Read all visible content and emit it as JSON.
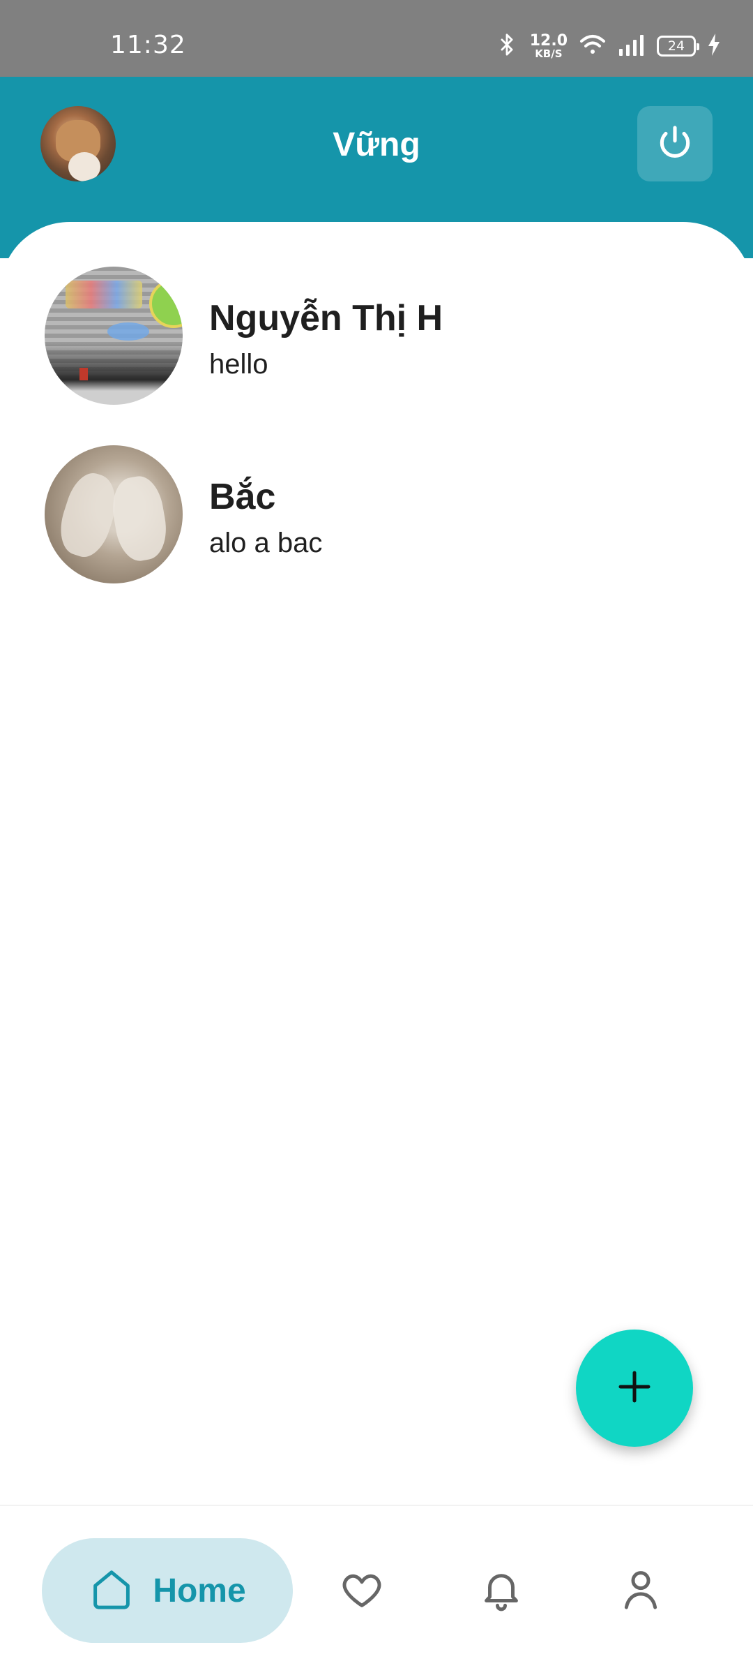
{
  "status_bar": {
    "time": "11:32",
    "net_speed_value": "12.0",
    "net_speed_unit": "KB/S",
    "battery_level": "24",
    "icons": [
      "bluetooth-icon",
      "wifi-icon",
      "signal-icon",
      "battery-icon",
      "charging-icon"
    ]
  },
  "header": {
    "title": "Vững",
    "avatar_icon": "user-avatar",
    "power_icon": "power-icon",
    "background_color": "#1595aa"
  },
  "chats": [
    {
      "name": "Nguyễn Thị H",
      "preview": "hello"
    },
    {
      "name": "Bắc",
      "preview": "alo a bac"
    }
  ],
  "fab": {
    "icon": "plus-icon",
    "color": "#10d6c4"
  },
  "bottom_nav": {
    "items": [
      {
        "label": "Home",
        "icon": "home-icon",
        "active": true
      },
      {
        "label": "",
        "icon": "heart-icon",
        "active": false
      },
      {
        "label": "",
        "icon": "bell-icon",
        "active": false
      },
      {
        "label": "",
        "icon": "person-icon",
        "active": false
      }
    ],
    "active_color": "#1595aa",
    "active_bg": "#cfe8ee"
  }
}
